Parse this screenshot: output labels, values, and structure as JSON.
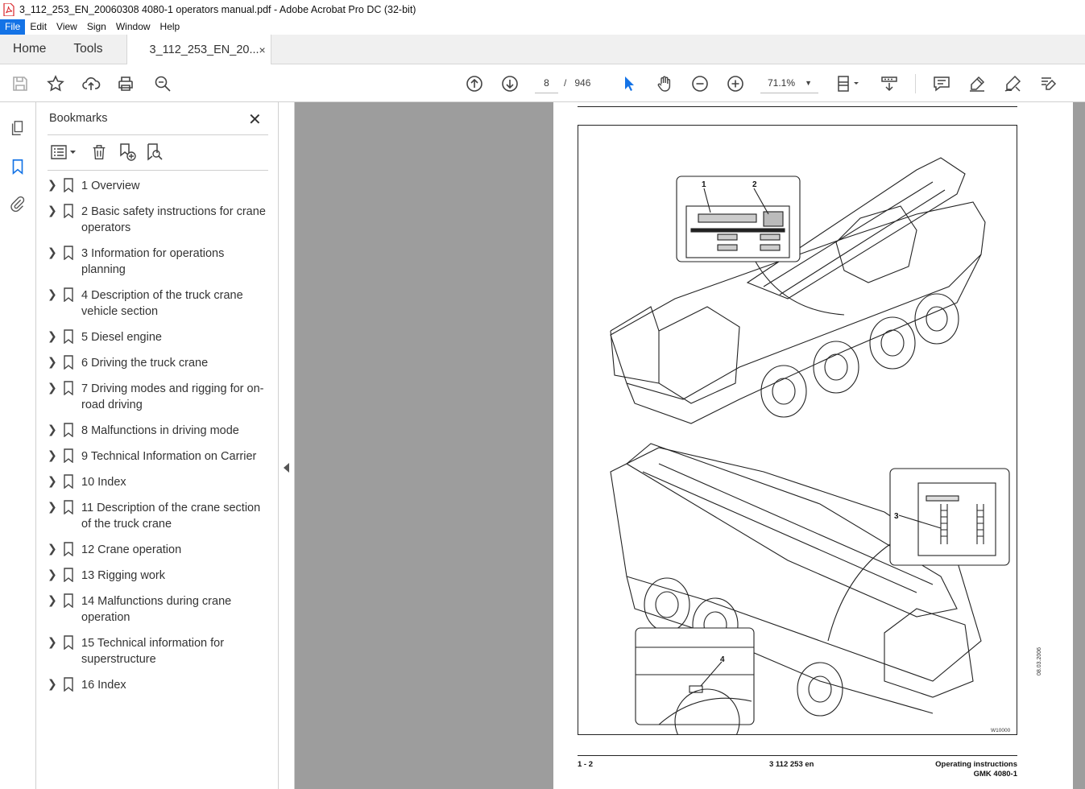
{
  "window": {
    "title": "3_112_253_EN_20060308  4080-1 operators manual.pdf - Adobe Acrobat Pro DC (32-bit)"
  },
  "menu": {
    "items": [
      "File",
      "Edit",
      "View",
      "Sign",
      "Window",
      "Help"
    ]
  },
  "tabs": {
    "home": "Home",
    "tools": "Tools",
    "document": "3_112_253_EN_20...",
    "close": "×"
  },
  "toolbar": {
    "page_current": "8",
    "page_separator": "/",
    "page_total": "946",
    "zoom": "71.1%"
  },
  "bookmarks": {
    "title": "Bookmarks",
    "close": "✕",
    "items": [
      "1 Overview",
      "2 Basic safety instructions for crane operators",
      "3 Information for operations planning",
      "4 Description of the truck crane vehicle section",
      "5 Diesel engine",
      "6 Driving the truck crane",
      "7 Driving modes and rigging for on-road driving",
      "8 Malfunctions in driving mode",
      "9 Technical Information on Carrier",
      "10 Index",
      "11 Description of the crane section of the truck crane",
      "12 Crane operation",
      "13 Rigging work",
      "14 Malfunctions during crane operation",
      "15 Technical information for superstructure",
      "16 Index"
    ]
  },
  "page": {
    "callouts": [
      "1",
      "2",
      "3",
      "4"
    ],
    "figure_code": "W10000",
    "side_date": "08.03.2006",
    "footer_left": "1 - 2",
    "footer_center": "3 112 253 en",
    "footer_right_1": "Operating instructions",
    "footer_right_2": "GMK 4080-1"
  },
  "colors": {
    "accent": "#1473e6",
    "viewer_bg": "#9d9d9d",
    "tab_bg": "#f0f0f0"
  }
}
